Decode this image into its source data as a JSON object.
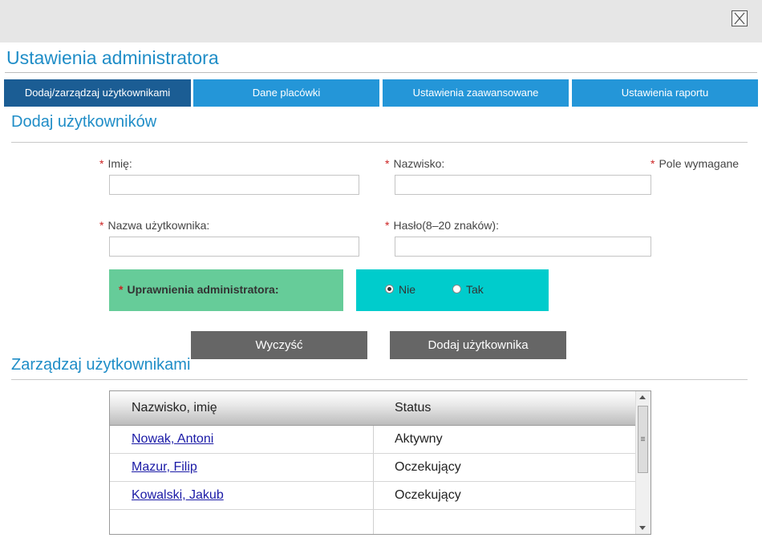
{
  "window": {
    "title": "Ustawienia administratora",
    "close_icon": "close-icon"
  },
  "tabs": [
    {
      "label": "Dodaj/zarządzaj użytkownikami",
      "active": true
    },
    {
      "label": "Dane placówki",
      "active": false
    },
    {
      "label": "Ustawienia zaawansowane",
      "active": false
    },
    {
      "label": "Ustawienia raportu",
      "active": false
    }
  ],
  "add_users": {
    "title": "Dodaj użytkowników",
    "required_marker": "*",
    "required_note": "Pole wymagane",
    "first_name_label": "Imię:",
    "last_name_label": "Nazwisko:",
    "username_label": "Nazwa użytkownika:",
    "password_label": "Hasło(8–20 znaków):",
    "first_name_value": "",
    "last_name_value": "",
    "username_value": "",
    "password_value": "",
    "admin_rights_label": "Uprawnienia administratora:",
    "admin_options": [
      {
        "label": "Nie",
        "selected": true
      },
      {
        "label": "Tak",
        "selected": false
      }
    ],
    "clear_button": "Wyczyść",
    "add_button": "Dodaj użytkownika"
  },
  "manage_users": {
    "title": "Zarządzaj użytkownikami",
    "columns": [
      "Nazwisko, imię",
      "Status"
    ],
    "rows": [
      {
        "name": "Nowak, Antoni",
        "status": "Aktywny"
      },
      {
        "name": "Mazur, Filip",
        "status": "Oczekujący"
      },
      {
        "name": "Kowalski, Jakub",
        "status": "Oczekujący"
      }
    ]
  },
  "colors": {
    "accent_blue": "#1f8dc7",
    "tab_inactive": "#2496d8",
    "tab_active": "#1b5d94",
    "admin_label_bg": "#66cc99",
    "admin_options_bg": "#00cccc",
    "button_gray": "#666666"
  }
}
